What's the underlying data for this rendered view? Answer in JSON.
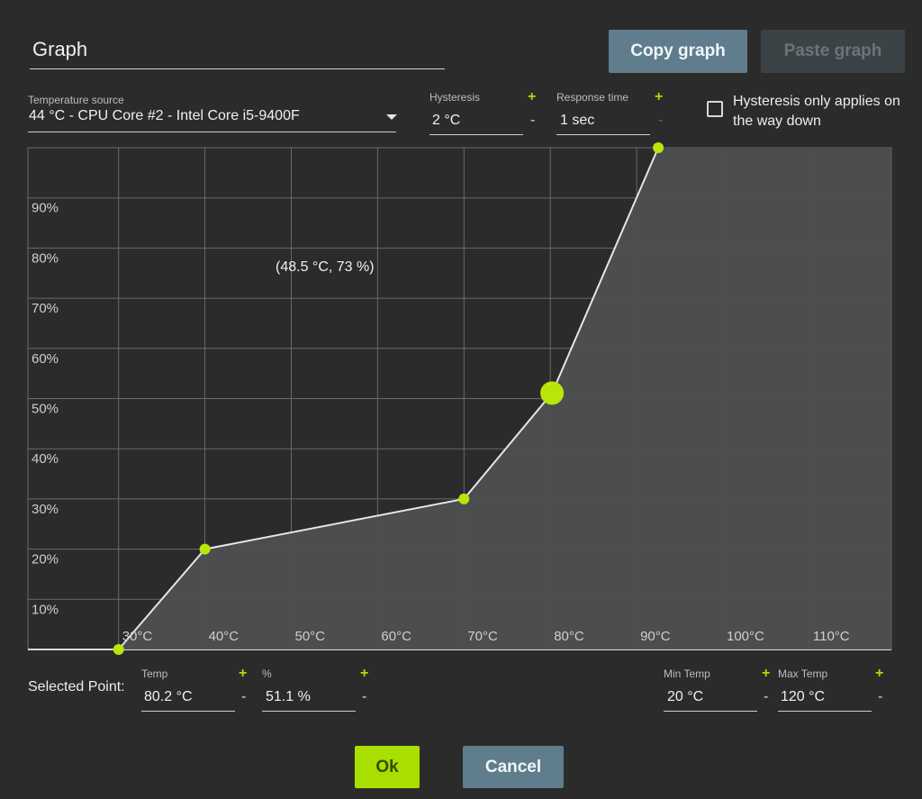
{
  "header": {
    "title": "Graph",
    "copy_label": "Copy graph",
    "paste_label": "Paste graph"
  },
  "source": {
    "label": "Temperature source",
    "value": "44 °C - CPU Core #2 - Intel Core i5-9400F"
  },
  "hysteresis": {
    "label": "Hysteresis",
    "value": "2 °C",
    "plus": "+",
    "minus": "-"
  },
  "response": {
    "label": "Response time",
    "value": "1 sec",
    "plus": "+",
    "minus": "-"
  },
  "option": {
    "hysteresis_down_label": "Hysteresis only applies on the way down",
    "checked": false
  },
  "graph": {
    "tooltip": "(48.5 °C, 73 %)",
    "x_tick_labels": [
      "30°C",
      "40°C",
      "50°C",
      "60°C",
      "70°C",
      "80°C",
      "90°C",
      "100°C",
      "110°C"
    ],
    "y_tick_labels": [
      "10%",
      "20%",
      "30%",
      "40%",
      "50%",
      "60%",
      "70%",
      "80%",
      "90%"
    ],
    "fill_color": "#4d4f50",
    "line_color": "#e6e6e6",
    "point_color": "#b8e60a",
    "grid_color": "#6b6b6b"
  },
  "chart_data": {
    "type": "area",
    "x": [
      30,
      40,
      70,
      80.2,
      92.5
    ],
    "y": [
      0,
      20,
      30,
      51.1,
      100
    ],
    "selected_index": 3,
    "xlim": [
      19.5,
      119.5
    ],
    "ylim": [
      0,
      100
    ],
    "grid": true
  },
  "selected": {
    "label": "Selected Point:",
    "temp_label": "Temp",
    "temp_value": "80.2 °C",
    "pct_label": "%",
    "pct_value": "51.1 %",
    "plus": "+",
    "minus": "-"
  },
  "limits": {
    "min_label": "Min Temp",
    "min_value": "20 °C",
    "max_label": "Max Temp",
    "max_value": "120 °C",
    "plus": "+",
    "minus": "-"
  },
  "footer": {
    "ok_label": "Ok",
    "cancel_label": "Cancel"
  }
}
